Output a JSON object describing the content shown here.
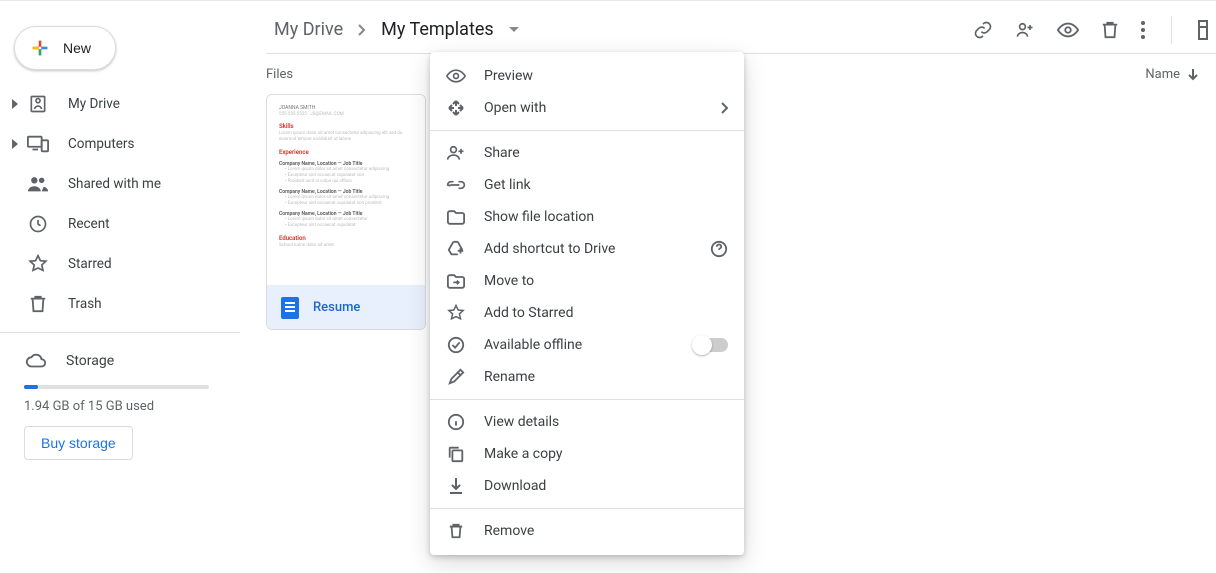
{
  "new_button": "New",
  "sidebar": {
    "items": [
      {
        "label": "My Drive",
        "expandable": true
      },
      {
        "label": "Computers",
        "expandable": true
      },
      {
        "label": "Shared with me",
        "expandable": false
      },
      {
        "label": "Recent",
        "expandable": false
      },
      {
        "label": "Starred",
        "expandable": false
      },
      {
        "label": "Trash",
        "expandable": false
      }
    ],
    "storage_label": "Storage",
    "storage_text": "1.94 GB of 15 GB used",
    "buy_label": "Buy storage"
  },
  "breadcrumbs": {
    "root": "My Drive",
    "current": "My Templates"
  },
  "section": {
    "files_label": "Files",
    "sort_label": "Name"
  },
  "file": {
    "name": "Resume"
  },
  "context_menu": {
    "preview": "Preview",
    "open_with": "Open with",
    "share": "Share",
    "get_link": "Get link",
    "show_location": "Show file location",
    "add_shortcut": "Add shortcut to Drive",
    "move_to": "Move to",
    "add_starred": "Add to Starred",
    "available_offline": "Available offline",
    "rename": "Rename",
    "view_details": "View details",
    "make_copy": "Make a copy",
    "download": "Download",
    "remove": "Remove"
  }
}
